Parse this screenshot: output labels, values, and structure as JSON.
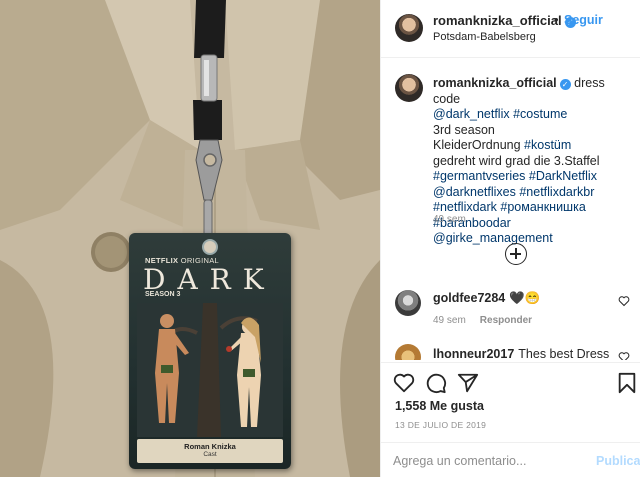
{
  "post": {
    "username": "romanknizka_official",
    "verified_icon": "verified-badge-icon",
    "follow_separator": "•",
    "follow_label": "Seguir",
    "location": "Potsdam-Babelsberg"
  },
  "photo": {
    "badge": {
      "brand": "NETFLIX",
      "brand_suffix": "ORIGINAL",
      "title": "DARK",
      "season": "SEASON 3",
      "name": "Roman Knizka",
      "role": "Cast"
    }
  },
  "caption": {
    "username": "romanknizka_official",
    "lead_text": "dress code",
    "tag1": "@dark_netflix",
    "tag2": "#costume",
    "line1": "3rd season",
    "line2_text": "KleiderOrdnung",
    "line2_tag": "#kostüm",
    "line3": "gedreht wird grad die 3.Staffel",
    "tags_a": "#germantvseries #DarkNetflix",
    "tags_b": "@darknetflixes #netflixdarkbr",
    "tags_c": "#netflixdark #романкнишка",
    "tags_d": "#baranboodar @girke_management",
    "time": "49 sem"
  },
  "comments": [
    {
      "username": "goldfee7284",
      "text": "🖤😁",
      "time": "49 sem",
      "reply_label": "Responder"
    },
    {
      "username": "lhonneur2017",
      "text": "Thes best Dress"
    }
  ],
  "actions": {
    "like_icon": "heart-icon",
    "comment_icon": "comment-icon",
    "share_icon": "share-icon",
    "save_icon": "bookmark-icon"
  },
  "likes": "1,558 Me gusta",
  "date": "13 DE JULIO DE 2019",
  "add_comment": {
    "placeholder": "Agrega un comentario...",
    "post_label": "Publicar"
  },
  "colors": {
    "link": "#00376b",
    "accent": "#3897f0",
    "post_disabled": "#b3dbff",
    "muted": "#8e8e8e"
  }
}
